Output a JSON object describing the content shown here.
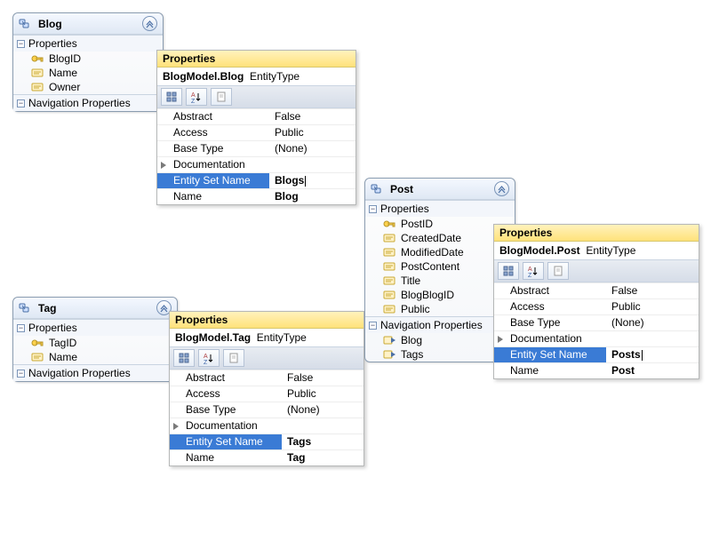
{
  "entities": {
    "blog": {
      "title": "Blog",
      "sections": {
        "properties": "Properties",
        "navigation": "Navigation Properties"
      },
      "props": [
        "BlogID",
        "Name",
        "Owner"
      ],
      "nav": []
    },
    "tag": {
      "title": "Tag",
      "sections": {
        "properties": "Properties",
        "navigation": "Navigation Properties"
      },
      "props": [
        "TagID",
        "Name"
      ],
      "nav": []
    },
    "post": {
      "title": "Post",
      "sections": {
        "properties": "Properties",
        "navigation": "Navigation Properties"
      },
      "props": [
        "PostID",
        "CreatedDate",
        "ModifiedDate",
        "PostContent",
        "Title",
        "BlogBlogID",
        "Public"
      ],
      "nav": [
        "Blog",
        "Tags"
      ]
    }
  },
  "propgrids": {
    "blog": {
      "title": "Properties",
      "object_path": "BlogModel.Blog",
      "object_type": "EntityType",
      "rows": [
        {
          "label": "Abstract",
          "value": "False"
        },
        {
          "label": "Access",
          "value": "Public"
        },
        {
          "label": "Base Type",
          "value": "(None)"
        },
        {
          "label": "Documentation",
          "value": "",
          "expandable": true
        },
        {
          "label": "Entity Set Name",
          "value": "Blogs",
          "selected": true,
          "bold": true,
          "cursor": true
        },
        {
          "label": "Name",
          "value": "Blog",
          "bold": true
        }
      ]
    },
    "tag": {
      "title": "Properties",
      "object_path": "BlogModel.Tag",
      "object_type": "EntityType",
      "rows": [
        {
          "label": "Abstract",
          "value": "False"
        },
        {
          "label": "Access",
          "value": "Public"
        },
        {
          "label": "Base Type",
          "value": "(None)"
        },
        {
          "label": "Documentation",
          "value": "",
          "expandable": true
        },
        {
          "label": "Entity Set Name",
          "value": "Tags",
          "selected": true,
          "bold": true
        },
        {
          "label": "Name",
          "value": "Tag",
          "bold": true
        }
      ]
    },
    "post": {
      "title": "Properties",
      "object_path": "BlogModel.Post",
      "object_type": "EntityType",
      "rows": [
        {
          "label": "Abstract",
          "value": "False"
        },
        {
          "label": "Access",
          "value": "Public"
        },
        {
          "label": "Base Type",
          "value": "(None)"
        },
        {
          "label": "Documentation",
          "value": "",
          "expandable": true
        },
        {
          "label": "Entity Set Name",
          "value": "Posts",
          "selected": true,
          "bold": true,
          "cursor": true
        },
        {
          "label": "Name",
          "value": "Post",
          "bold": true
        }
      ]
    }
  },
  "colors": {
    "select": "#3a7bd5",
    "propheader": "#ffe27a"
  }
}
